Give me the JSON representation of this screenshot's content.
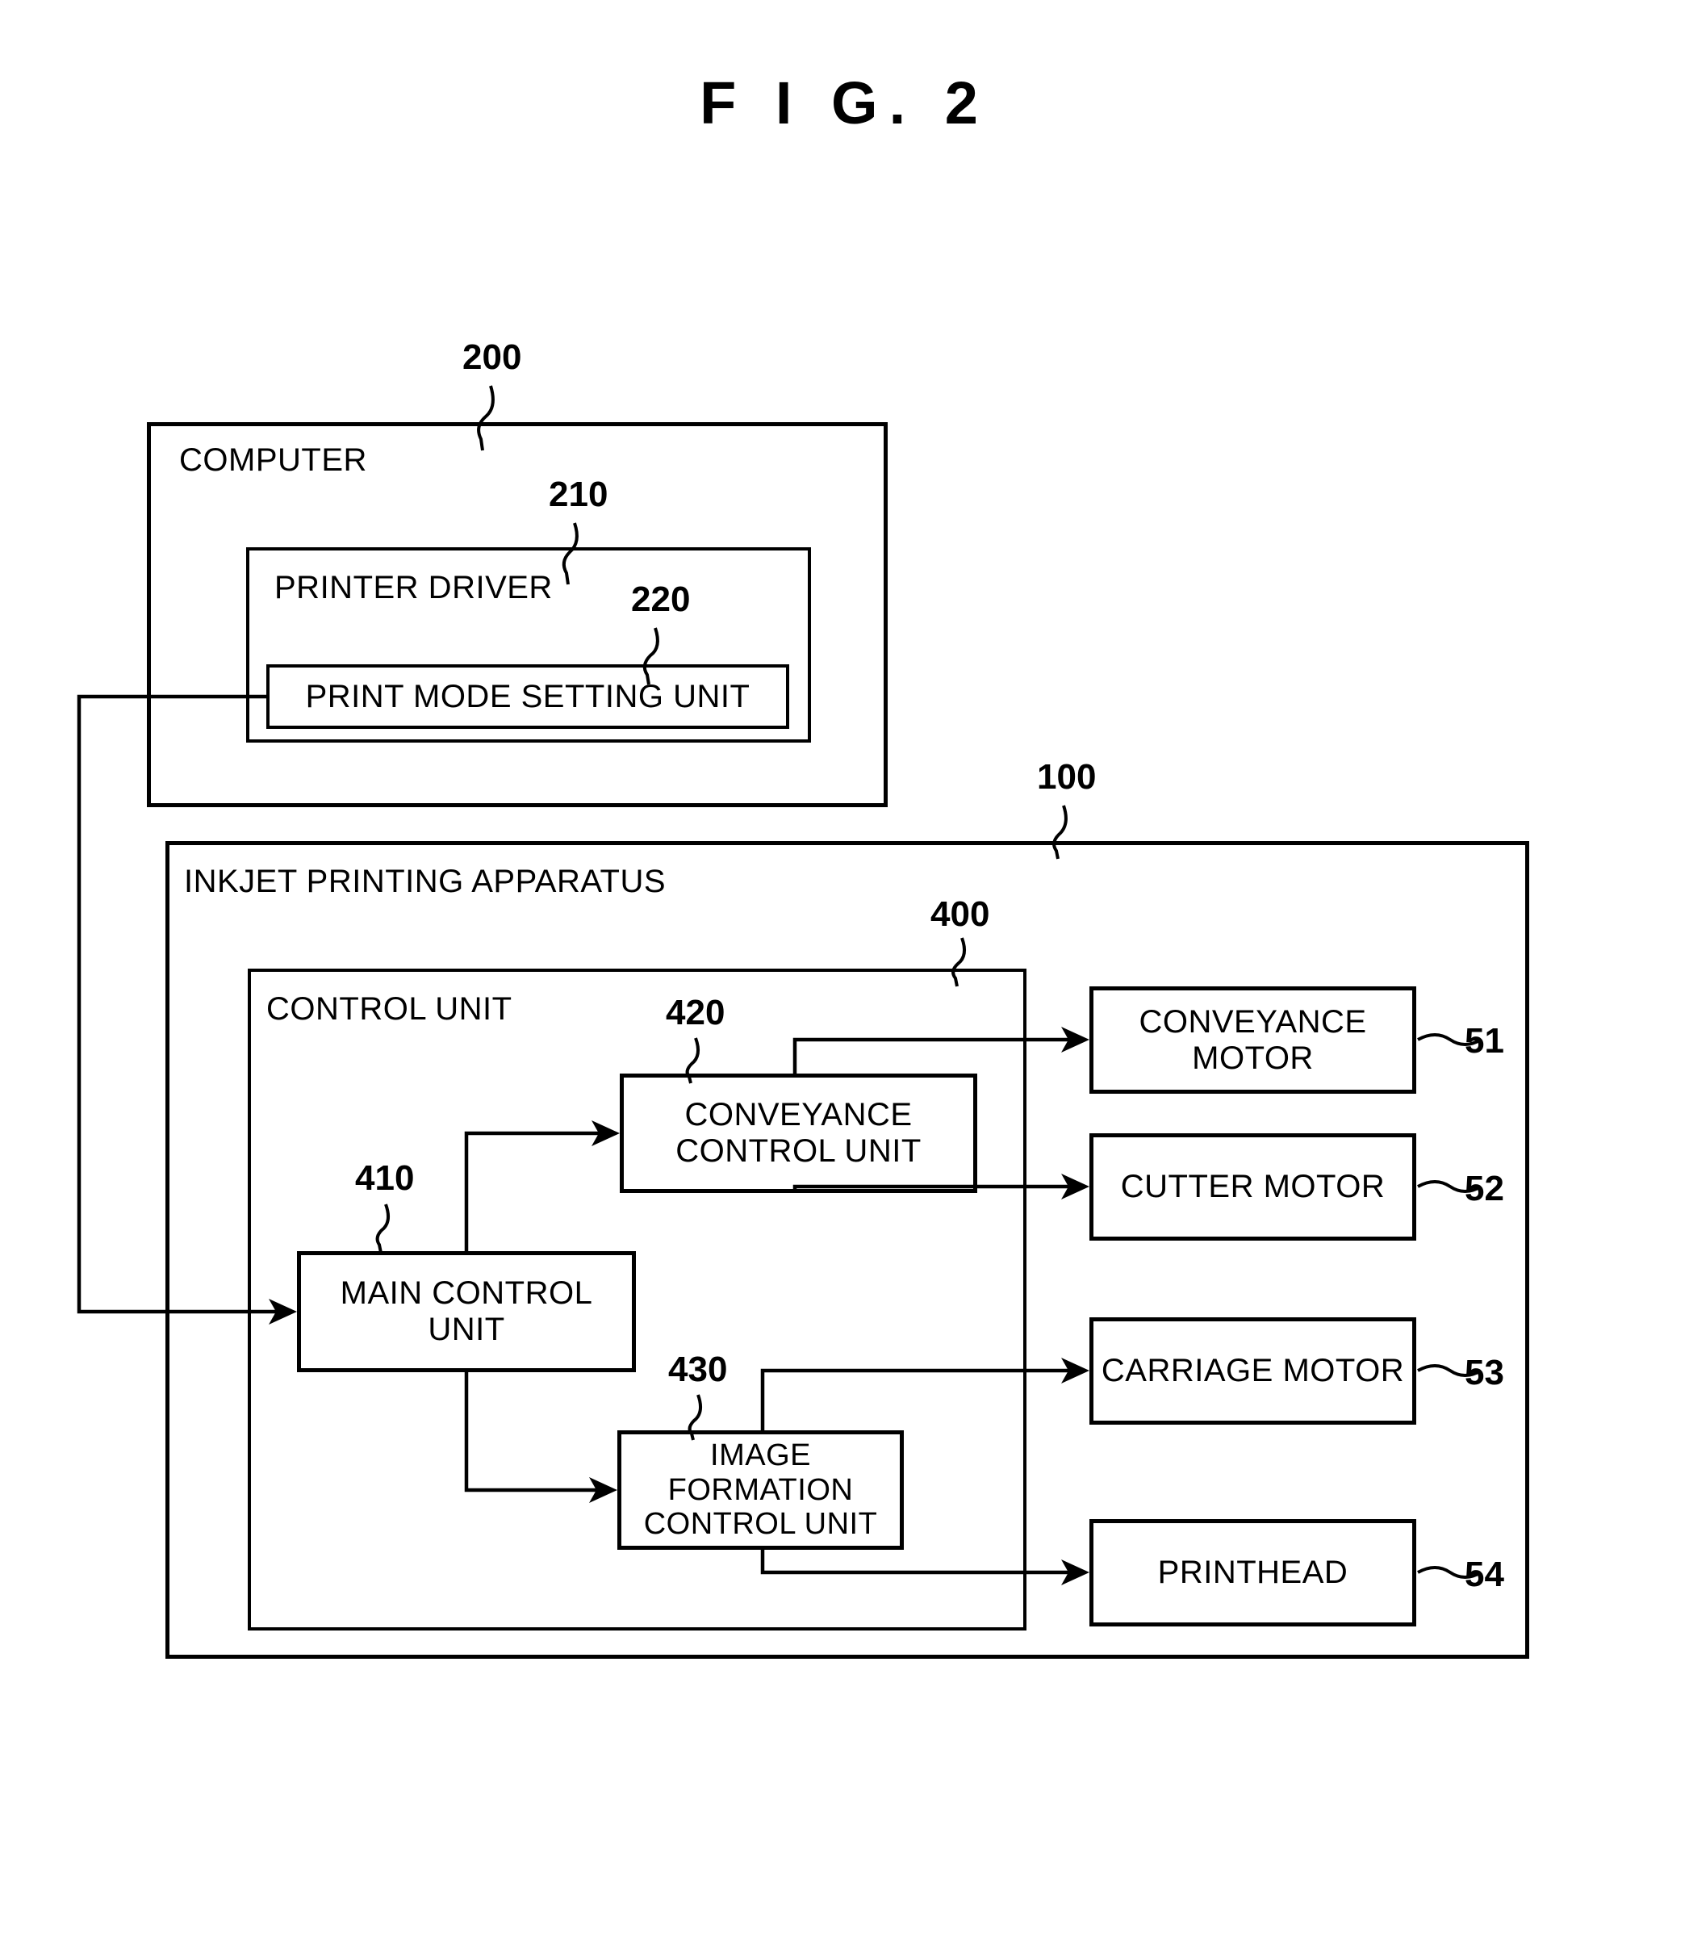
{
  "figure": {
    "title": "F I G.  2"
  },
  "computer": {
    "label": "COMPUTER",
    "ref": "200",
    "printer_driver": {
      "label": "PRINTER DRIVER",
      "ref": "210",
      "print_mode_setting_unit": {
        "label": "PRINT MODE SETTING UNIT",
        "ref": "220"
      }
    }
  },
  "apparatus": {
    "label": "INKJET PRINTING APPARATUS",
    "ref": "100",
    "control_unit": {
      "label": "CONTROL UNIT",
      "ref": "400",
      "blocks": [
        {
          "label": "MAIN CONTROL UNIT",
          "ref": "410"
        },
        {
          "label": "CONVEYANCE CONTROL UNIT",
          "ref": "420"
        },
        {
          "label": "IMAGE FORMATION CONTROL UNIT",
          "ref": "430"
        }
      ]
    },
    "peripherals": [
      {
        "label": "CONVEYANCE MOTOR",
        "ref": "51"
      },
      {
        "label": "CUTTER MOTOR",
        "ref": "52"
      },
      {
        "label": "CARRIAGE MOTOR",
        "ref": "53"
      },
      {
        "label": "PRINTHEAD",
        "ref": "54"
      }
    ]
  }
}
